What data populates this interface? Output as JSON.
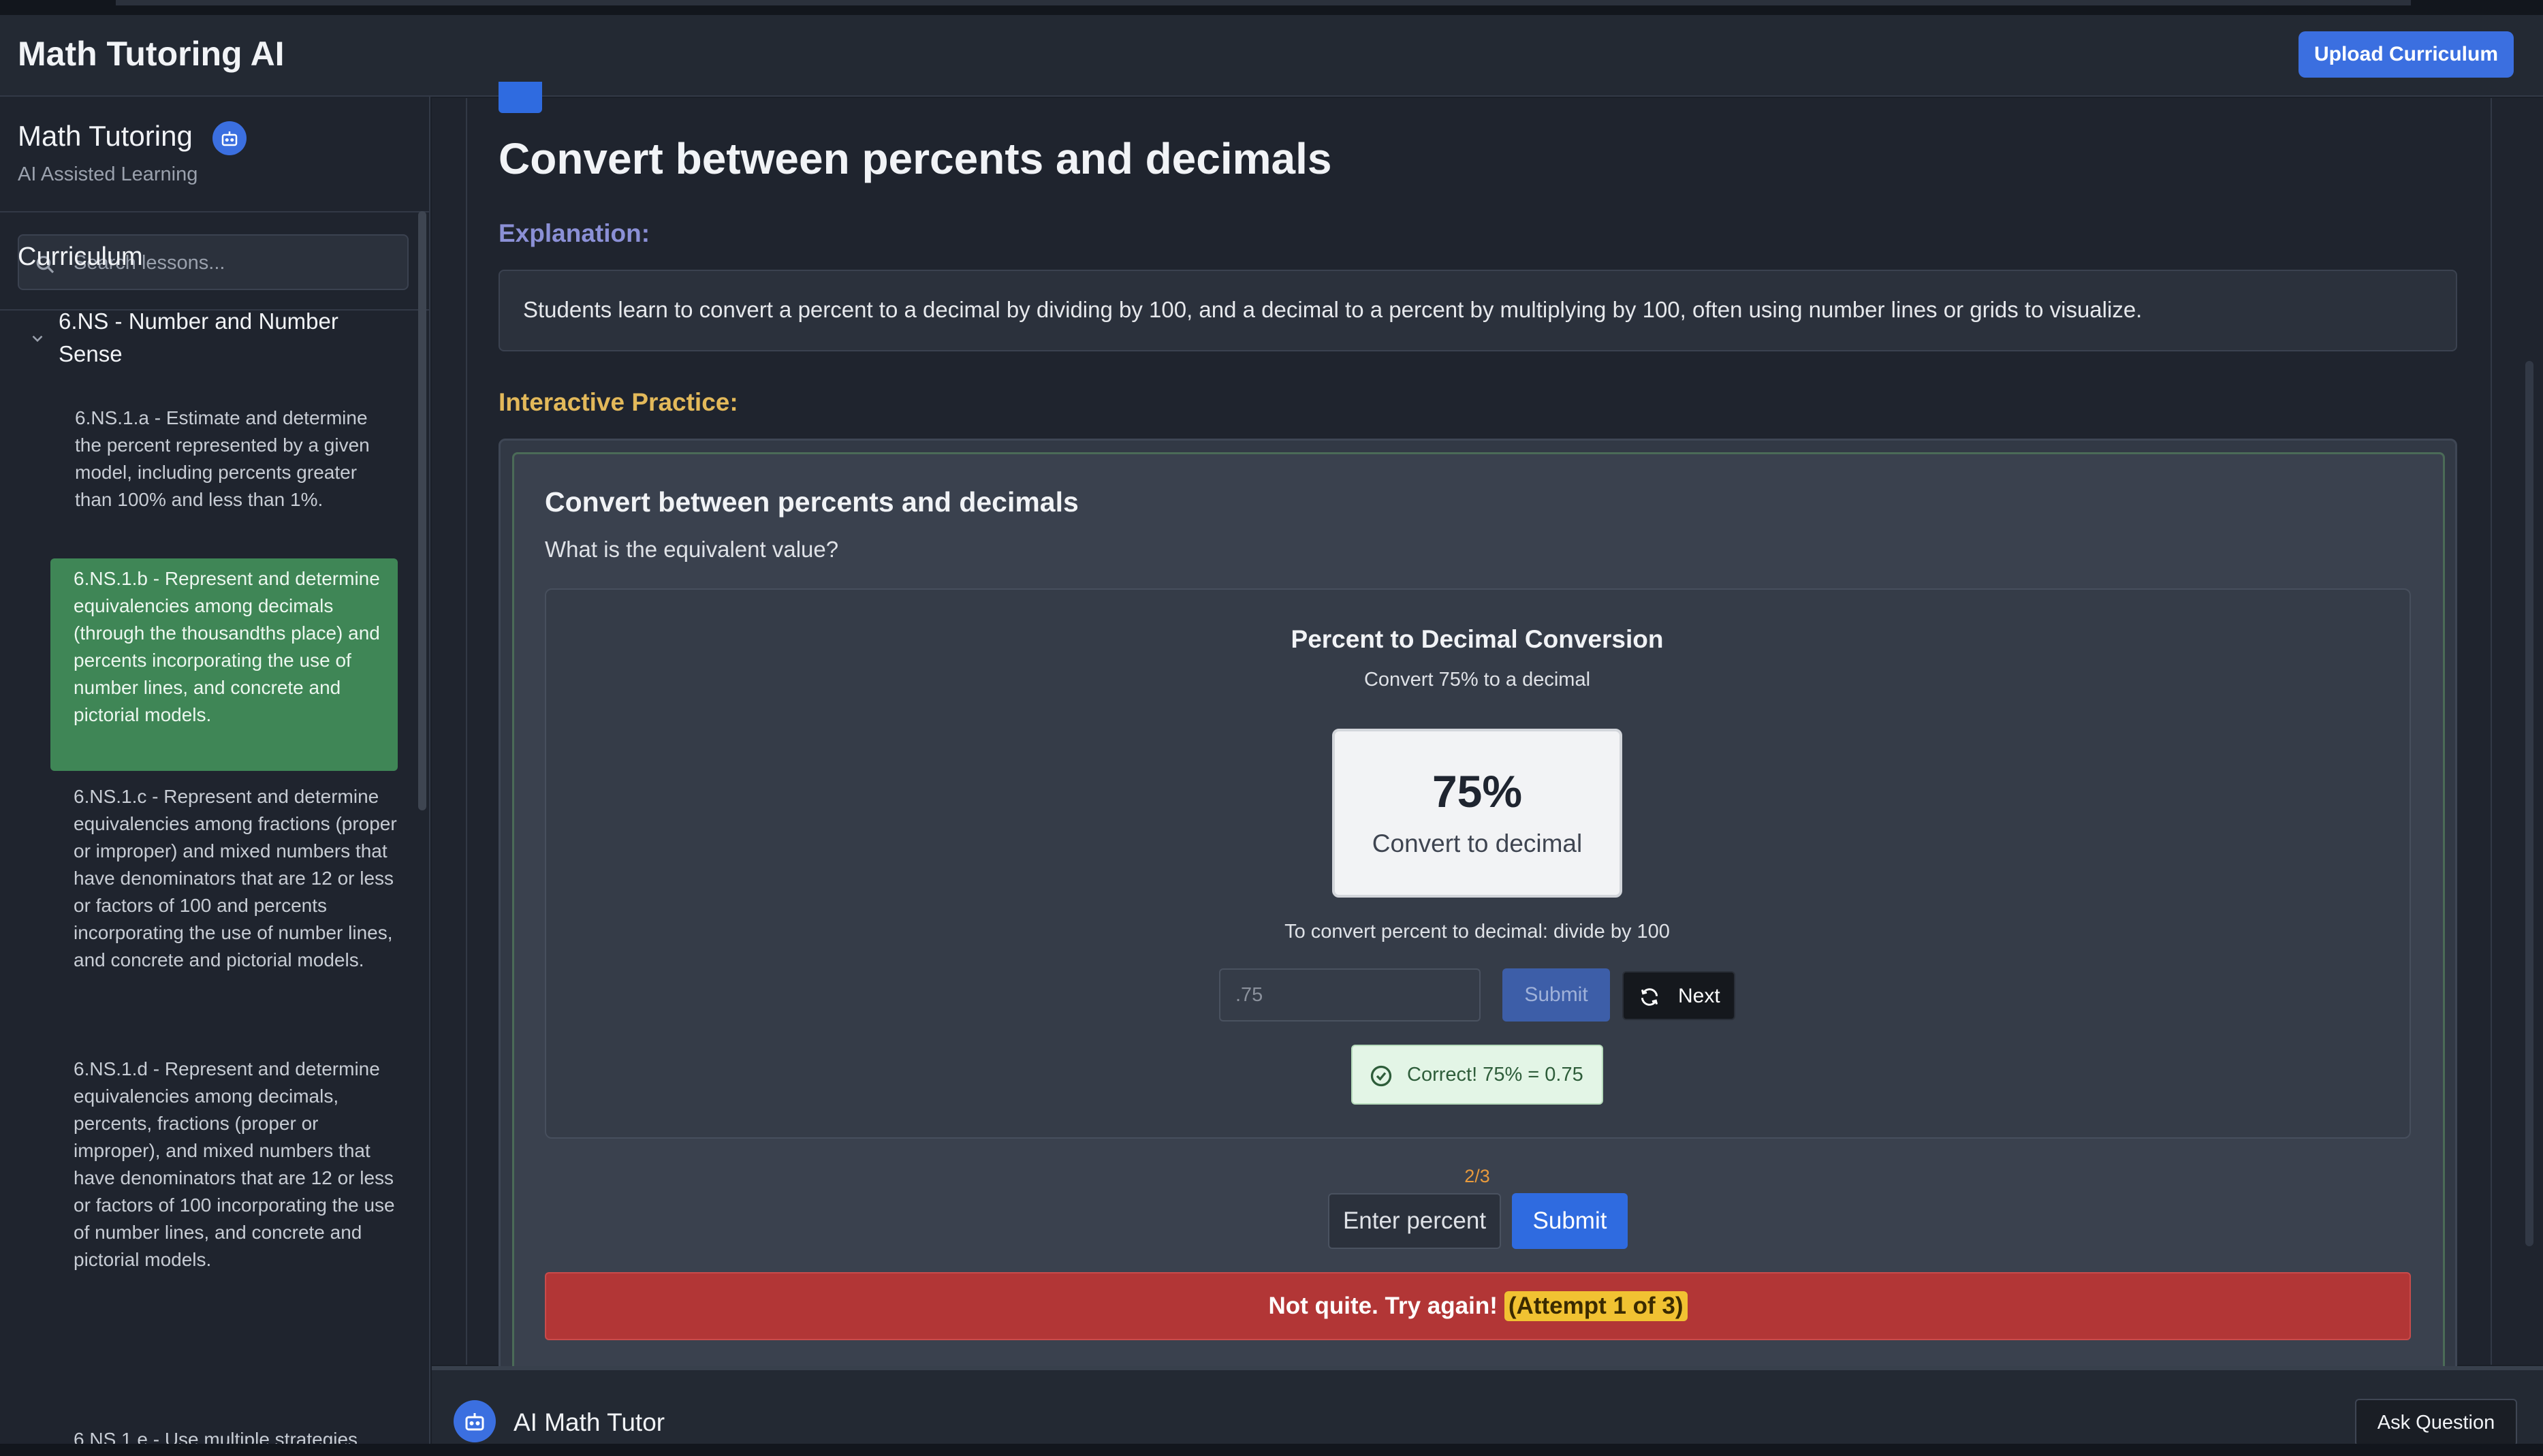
{
  "header": {
    "app_title": "Math Tutoring AI",
    "upload_label": "Upload Curriculum"
  },
  "sidebar": {
    "title": "Math Tutoring",
    "subtitle": "AI Assisted Learning",
    "search_placeholder": "Search lessons...",
    "curriculum_label": "Curriculum",
    "group_label": "6.NS - Number and Number Sense",
    "standards": [
      "6.NS.1.a - Estimate and determine the percent represented by a given model, including percents greater than 100% and less than 1%.",
      "6.NS.1.b - Represent and determine equivalencies among decimals (through the thousandths place) and percents incorporating the use of number lines, and concrete and pictorial models.",
      "6.NS.1.c - Represent and determine equivalencies among fractions (proper or improper) and mixed numbers that have denominators that are 12 or less or factors of 100 and percents incorporating the use of number lines, and concrete and pictorial models.",
      "6.NS.1.d - Represent and determine equivalencies among decimals, percents, fractions (proper or improper), and mixed numbers that have denominators that are 12 or less or factors of 100 incorporating the use of number lines, and concrete and pictorial models.",
      "6.NS.1.e - Use multiple strategies"
    ],
    "active_index": 1
  },
  "lesson": {
    "title": "Convert between percents and decimals",
    "explanation_label": "Explanation:",
    "explanation": "Students learn to convert a percent to a decimal by dividing by 100, and a decimal to a percent by multiplying by 100, often using number lines or grids to visualize.",
    "practice_label": "Interactive Practice:"
  },
  "practice": {
    "title": "Convert between percents and decimals",
    "question": "What is the equivalent value?",
    "card_title": "Percent to Decimal Conversion",
    "card_subtitle": "Convert 75% to a decimal",
    "percent_value": "75%",
    "percent_caption": "Convert to decimal",
    "hint": "To convert percent to decimal: divide by 100",
    "answer_value": ".75",
    "submit_label": "Submit",
    "next_label": "Next",
    "correct_message": "Correct! 75% = 0.75",
    "attempt_count": "2/3",
    "percent_placeholder": "Enter percent",
    "submit2_label": "Submit",
    "error_message": "Not quite. Try again!",
    "error_attempt": "(Attempt 1 of 3)"
  },
  "tutor": {
    "label": "AI Math Tutor",
    "ask_label": "Ask Question"
  },
  "colors": {
    "accent": "#3b6fe0",
    "success_bg": "#3f8656",
    "error_bg": "#b23636",
    "explanation_label": "#8b90d6",
    "practice_label": "#e3b95a"
  }
}
